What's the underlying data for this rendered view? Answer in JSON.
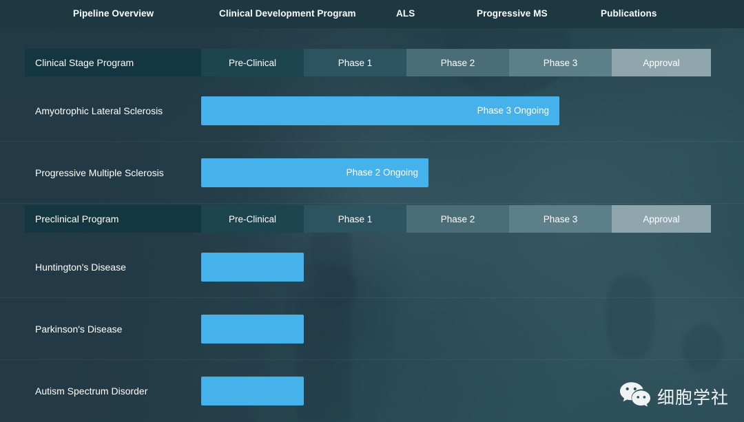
{
  "nav": {
    "items": [
      {
        "label": "Pipeline Overview"
      },
      {
        "label": "Clinical Development Program"
      },
      {
        "label": "ALS"
      },
      {
        "label": "Progressive MS"
      },
      {
        "label": "Publications"
      }
    ]
  },
  "colors": {
    "accent_bar": "#45b2ec",
    "nav_background": "#1e3842",
    "header_name_cell": "#133640",
    "stage_preclinical": "#1d4550",
    "stage_phase1": "#2c5460",
    "stage_phase2": "#4a6d78",
    "stage_phase3": "#5c7f89",
    "stage_approval": "#8fa6ad"
  },
  "clinical_section": {
    "header": {
      "name": "Clinical Stage Program",
      "stages": [
        "Pre-Clinical",
        "Phase 1",
        "Phase 2",
        "Phase 3",
        "Approval"
      ]
    },
    "rows": [
      {
        "label": "Amyotrophic Lateral Sclerosis",
        "status": "Phase 3 Ongoing"
      },
      {
        "label": "Progressive Multiple Sclerosis",
        "status": "Phase 2 Ongoing"
      }
    ]
  },
  "preclinical_section": {
    "header": {
      "name": "Preclinical Program",
      "stages": [
        "Pre-Clinical",
        "Phase 1",
        "Phase 2",
        "Phase 3",
        "Approval"
      ]
    },
    "rows": [
      {
        "label": "Huntington's Disease",
        "status": ""
      },
      {
        "label": "Parkinson's Disease",
        "status": ""
      },
      {
        "label": "Autism Spectrum Disorder",
        "status": ""
      }
    ]
  },
  "watermark": {
    "text": "细胞学社",
    "icon": "wechat-icon"
  }
}
